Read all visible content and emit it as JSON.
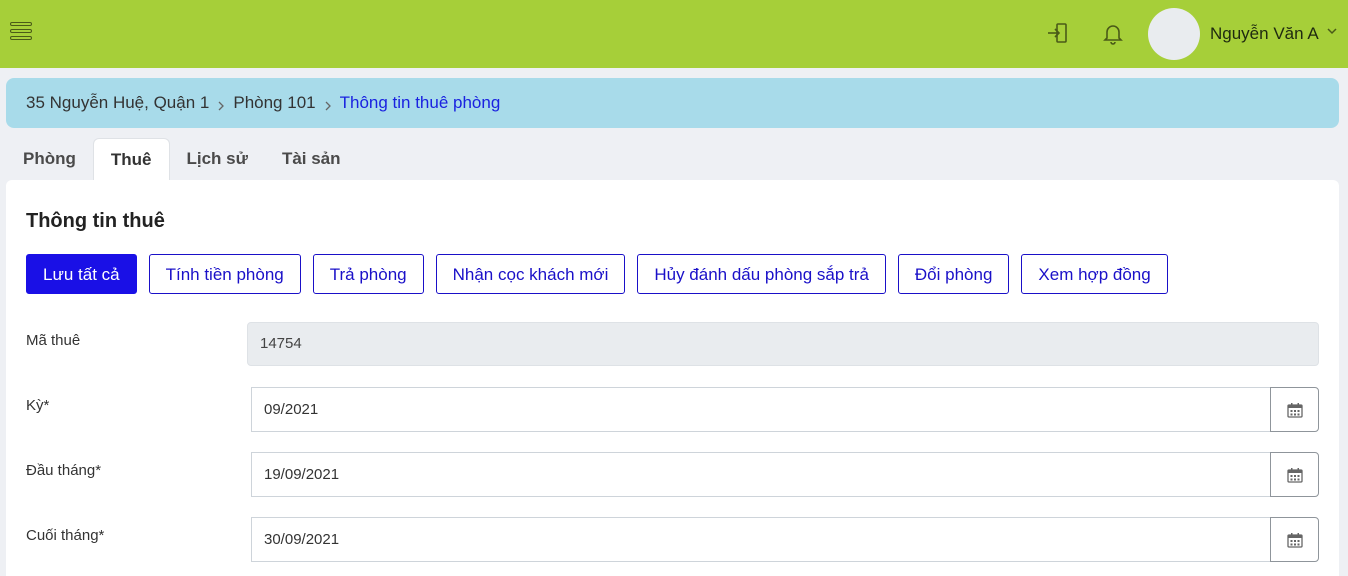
{
  "header": {
    "user_name": "Nguyễn Văn A"
  },
  "breadcrumb": {
    "items": [
      "35 Nguyễn Huệ, Quận 1",
      "Phòng 101"
    ],
    "active": "Thông tin thuê phòng"
  },
  "tabs": [
    {
      "label": "Phòng"
    },
    {
      "label": "Thuê"
    },
    {
      "label": "Lịch sử"
    },
    {
      "label": "Tài sản"
    }
  ],
  "active_tab": "Thuê",
  "form": {
    "title": "Thông tin thuê",
    "actions": [
      {
        "label": "Lưu tất cả"
      },
      {
        "label": "Tính tiền phòng"
      },
      {
        "label": "Trả phòng"
      },
      {
        "label": "Nhận cọc khách mới"
      },
      {
        "label": "Hủy đánh dấu phòng sắp trả"
      },
      {
        "label": "Đổi phòng"
      },
      {
        "label": "Xem hợp đồng"
      }
    ],
    "fields": {
      "rental_code": {
        "label": "Mã thuê",
        "value": "14754"
      },
      "period": {
        "label": "Kỳ*",
        "value": "09/2021"
      },
      "start_date": {
        "label": "Đầu tháng*",
        "value": "19/09/2021"
      },
      "end_date": {
        "label": "Cuối tháng*",
        "value": "30/09/2021"
      }
    }
  },
  "colors": {
    "topbar": "#a6cf39",
    "breadcrumb_bg": "#a8dbea",
    "accent": "#1a10e6"
  },
  "icons": [
    "menu-icon",
    "exit-door-icon",
    "bell-icon",
    "chevron-down-icon",
    "chevron-right-icon",
    "calendar-icon"
  ]
}
